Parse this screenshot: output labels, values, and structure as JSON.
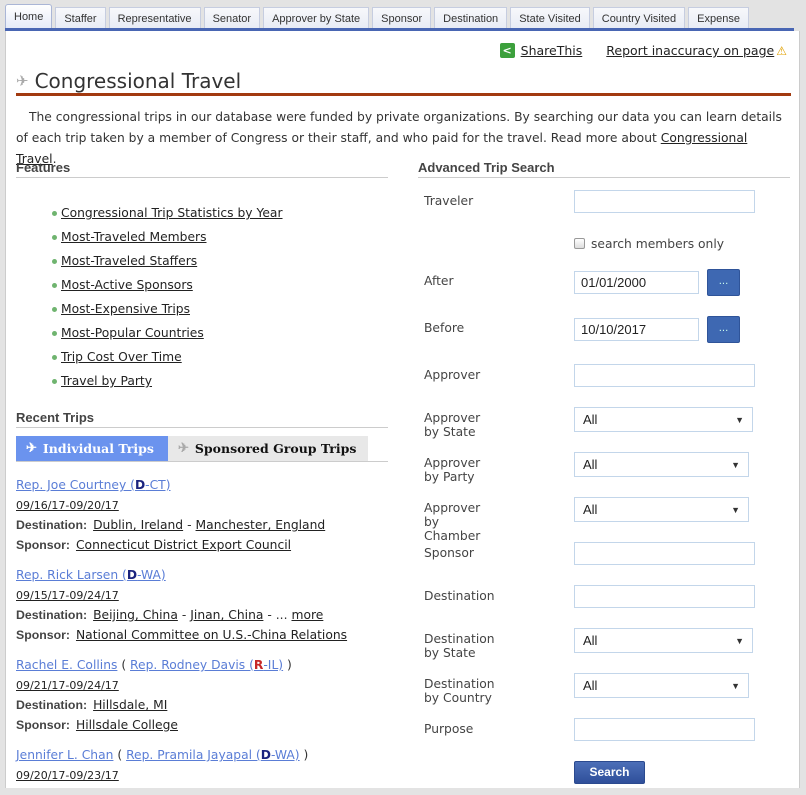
{
  "tabs": [
    {
      "label": "Home",
      "active": true
    },
    {
      "label": "Staffer"
    },
    {
      "label": "Representative"
    },
    {
      "label": "Senator"
    },
    {
      "label": "Approver by State"
    },
    {
      "label": "Sponsor"
    },
    {
      "label": "Destination"
    },
    {
      "label": "State Visited"
    },
    {
      "label": "Country Visited"
    },
    {
      "label": "Expense"
    }
  ],
  "toplinks": {
    "share_label": "ShareThis",
    "report_label": "Report inaccuracy on page"
  },
  "header": {
    "title": "Congressional Travel",
    "intro": "The congressional trips in our database were funded by private organizations. By searching our data you can learn details of each trip taken by a member of Congress or their staff, and who paid for the travel. Read more about ",
    "intro_link": "Congressional Travel",
    "intro_end": "."
  },
  "features": {
    "heading": "Features",
    "items": [
      "Congressional Trip Statistics by Year",
      "Most-Traveled Members",
      "Most-Traveled Staffers",
      "Most-Active Sponsors",
      "Most-Expensive Trips",
      "Most-Popular Countries",
      "Trip Cost Over Time",
      "Travel by Party"
    ]
  },
  "recent": {
    "heading": "Recent Trips",
    "tab_individual": "Individual Trips",
    "tab_group": "Sponsored Group Trips",
    "destination_label": "Destination:",
    "sponsor_label": "Sponsor:",
    "trips": [
      {
        "staffer": "",
        "member_prefix": "Rep. Joe Courtney (",
        "party": "D",
        "member_suffix": "-CT)",
        "dates": "09/16/17-09/20/17",
        "destinations": [
          "Dublin, Ireland",
          "Manchester, England"
        ],
        "more": "",
        "sponsor": "Connecticut District Export Council"
      },
      {
        "staffer": "",
        "member_prefix": "Rep. Rick Larsen (",
        "party": "D",
        "member_suffix": "-WA)",
        "dates": "09/15/17-09/24/17",
        "destinations": [
          "Beijing, China",
          "Jinan, China"
        ],
        "more": "more",
        "sponsor": "National Committee on U.S.-China Relations"
      },
      {
        "staffer": "Rachel E. Collins",
        "member_prefix": "Rep. Rodney Davis (",
        "party": "R",
        "member_suffix": "-IL)",
        "dates": "09/21/17-09/24/17",
        "destinations": [
          "Hillsdale, MI"
        ],
        "more": "",
        "sponsor": "Hillsdale College"
      },
      {
        "staffer": "Jennifer L. Chan",
        "member_prefix": "Rep. Pramila Jayapal (",
        "party": "D",
        "member_suffix": "-WA)",
        "dates": "09/20/17-09/23/17",
        "destinations": [],
        "more": "",
        "sponsor": ""
      }
    ]
  },
  "search": {
    "heading": "Advanced Trip Search",
    "traveler_label": "Traveler",
    "traveler_value": "",
    "members_only_label": "search members only",
    "after_label": "After",
    "after_value": "01/01/2000",
    "before_label": "Before",
    "before_value": "10/10/2017",
    "calendar_button": "...",
    "approver_label": "Approver",
    "approver_value": "",
    "approver_state_label": "Approver by State",
    "approver_state_value": "All",
    "approver_party_label": "Approver by Party",
    "approver_party_value": "All",
    "approver_chamber_label": "Approver by Chamber",
    "approver_chamber_value": "All",
    "sponsor_label": "Sponsor",
    "sponsor_value": "",
    "destination_label": "Destination",
    "destination_value": "",
    "destination_state_label": "Destination by State",
    "destination_state_value": "All",
    "destination_country_label": "Destination by Country",
    "destination_country_value": "All",
    "purpose_label": "Purpose",
    "purpose_value": "",
    "submit_label": "Search"
  },
  "colors": {
    "tab_accent": "#4966b3",
    "title_rule": "#a23a10",
    "active_trip_tab": "#6b93ee",
    "link_blue": "#5a7dd6",
    "party_d": "#1a237e",
    "party_r": "#c62828",
    "button_blue": "#3e68b2"
  }
}
